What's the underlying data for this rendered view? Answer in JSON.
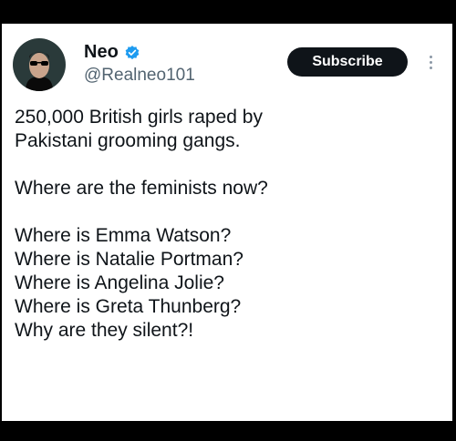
{
  "author": {
    "name": "Neo",
    "handle": "@Realneo101",
    "verified_color": "#1d9bf0"
  },
  "actions": {
    "subscribe_label": "Subscribe",
    "more_icon": "more-vertical-icon"
  },
  "tweet": {
    "lines": [
      "250,000 British girls raped by",
      "Pakistani grooming gangs.",
      "",
      "Where are the feminists now?",
      "",
      "Where is Emma Watson?",
      "Where is Natalie Portman?",
      "Where is Angelina Jolie?",
      "Where is Greta Thunberg?",
      "Why are they silent?!"
    ]
  }
}
